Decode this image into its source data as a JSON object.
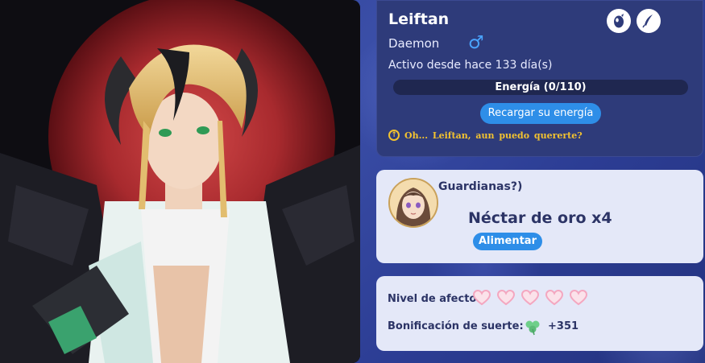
{
  "character": {
    "name": "Leiftan",
    "race": "Daemon",
    "gender_symbol": "♂",
    "active_since": "Activo desde hace 133 día(s)"
  },
  "energy": {
    "label": "Energía (0/110)",
    "current": 0,
    "max": 110,
    "recharge_label": "Recargar su energía"
  },
  "quote": {
    "icon": "up-arrow-circle-icon",
    "text": "Oh... Leiftan, aun puedo quererte?"
  },
  "badges": [
    "egg-icon",
    "feather-icon"
  ],
  "feeding": {
    "title": "Guardianas?)",
    "item": "Néctar de oro x4",
    "button_label": "Alimentar"
  },
  "stats": {
    "affection_label": "Nivel de afecto",
    "hearts_count": 5,
    "luck_label": "Bonificación de suerte:",
    "luck_icon": "clover-icon",
    "luck_value": "+351"
  },
  "colors": {
    "accent_blue": "#2e8ee8",
    "quote_gold": "#f2c230",
    "heart_pink": "#f4a7c0",
    "card_dark": "#2e3b7a",
    "card_light": "#e4e8f8"
  }
}
